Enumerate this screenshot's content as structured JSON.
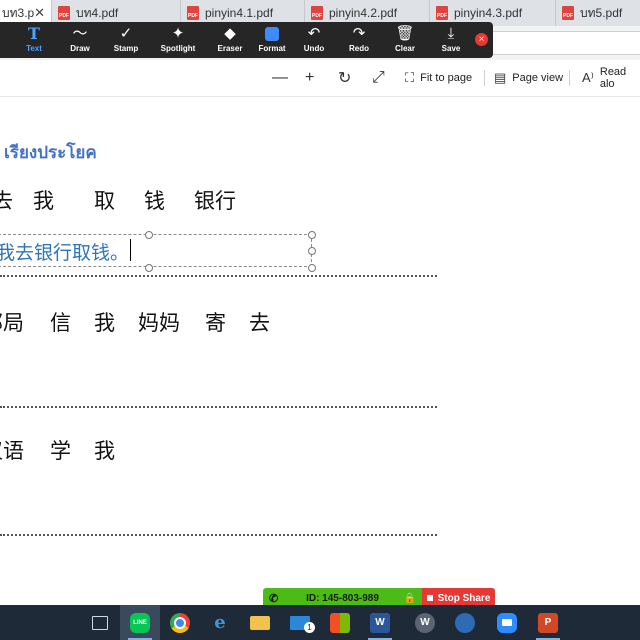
{
  "tabs": [
    {
      "label": "บท3.p",
      "active": true
    },
    {
      "label": "บท4.pdf",
      "active": false
    },
    {
      "label": "pinyin4.1.pdf",
      "active": false
    },
    {
      "label": "pinyin4.2.pdf",
      "active": false
    },
    {
      "label": "pinyin4.3.pdf",
      "active": false
    },
    {
      "label": "บท5.pdf",
      "active": false
    }
  ],
  "pdf_badge": "PDF",
  "annotation_toolbar": {
    "tools": [
      {
        "label": "Text",
        "icon": "text-icon"
      },
      {
        "label": "Draw",
        "icon": "draw-icon"
      },
      {
        "label": "Stamp",
        "icon": "stamp-icon"
      },
      {
        "label": "Spotlight",
        "icon": "spotlight-icon"
      },
      {
        "label": "Eraser",
        "icon": "eraser-icon"
      },
      {
        "label": "Format",
        "icon": "format-icon"
      },
      {
        "label": "Undo",
        "icon": "undo-icon"
      },
      {
        "label": "Redo",
        "icon": "redo-icon"
      },
      {
        "label": "Clear",
        "icon": "trash-icon"
      },
      {
        "label": "Save",
        "icon": "save-icon"
      }
    ],
    "active_tool": "Text",
    "format_color": "#3d8bfd"
  },
  "viewer_toolbar": {
    "fit_to_page": "Fit to page",
    "page_view": "Page view",
    "read_aloud": "Read alo"
  },
  "document": {
    "heading": "เรียงประโยค",
    "row1": [
      "去",
      "我",
      "取",
      "钱",
      "银行"
    ],
    "typed_text": "我去银行取钱。",
    "row2": [
      "邮局",
      "信",
      "我",
      "妈妈",
      "寄",
      "去"
    ],
    "row3": [
      "汉语",
      "学",
      "我"
    ]
  },
  "share_bar": {
    "meeting_id": "ID: 145-803-989",
    "stop_label": "Stop Share"
  },
  "taskbar": {
    "items": [
      "task-view-icon",
      "line-icon",
      "chrome-icon",
      "edge-icon",
      "file-explorer-icon",
      "mail-icon",
      "store-icon",
      "word-icon",
      "wps-icon",
      "app-icon",
      "zoom-icon",
      "powerpoint-icon"
    ],
    "mail_badge": "1",
    "line_label": "LINE",
    "word_label": "W",
    "wps_label": "W",
    "ppt_label": "P"
  }
}
